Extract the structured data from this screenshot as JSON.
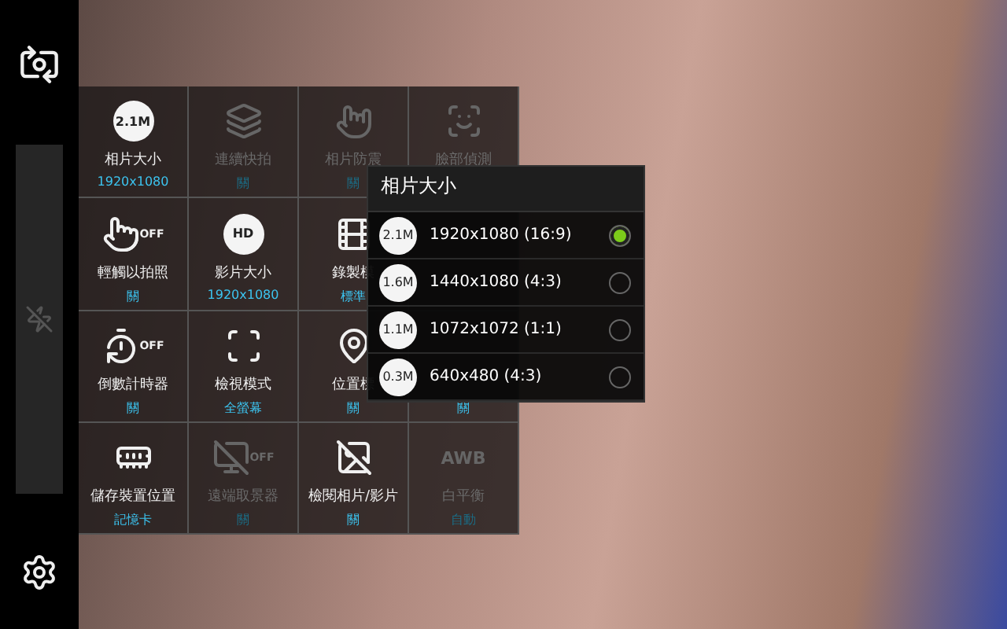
{
  "settings_grid": [
    [
      {
        "label": "相片大小",
        "value": "1920x1080",
        "badge": "2.1M",
        "disabled": false
      },
      {
        "label": "連續快拍",
        "value": "關",
        "disabled": true
      },
      {
        "label": "相片防震",
        "value": "關",
        "disabled": true
      },
      {
        "label": "臉部偵測",
        "disabled": true
      }
    ],
    [
      {
        "label": "輕觸以拍照",
        "value": "關",
        "badge": "OFF",
        "disabled": false
      },
      {
        "label": "影片大小",
        "value": "1920x1080",
        "badge": "HD",
        "disabled": false
      },
      {
        "label": "錄製模",
        "value": "標準",
        "disabled": false
      }
    ],
    [
      {
        "label": "倒數計時器",
        "value": "關",
        "badge": "OFF",
        "disabled": false
      },
      {
        "label": "檢視模式",
        "value": "全螢幕",
        "disabled": false
      },
      {
        "label": "位置標",
        "value": "關",
        "disabled": false
      },
      {
        "value": "關",
        "disabled": false
      }
    ],
    [
      {
        "label": "儲存裝置位置",
        "value": "記憶卡",
        "disabled": false
      },
      {
        "label": "遠端取景器",
        "value": "關",
        "badge": "OFF",
        "disabled": true
      },
      {
        "label": "檢閱相片/影片",
        "value": "關",
        "disabled": false
      },
      {
        "label": "白平衡",
        "value": "自動",
        "badge": "AWB",
        "disabled": true
      }
    ]
  ],
  "popup": {
    "title": "相片大小",
    "options": [
      {
        "badge": "2.1M",
        "label": "1920x1080 (16:9)",
        "selected": true
      },
      {
        "badge": "1.6M",
        "label": "1440x1080 (4:3)",
        "selected": false
      },
      {
        "badge": "1.1M",
        "label": "1072x1072 (1:1)",
        "selected": false
      },
      {
        "badge": "0.3M",
        "label": "640x480 (4:3)",
        "selected": false
      }
    ]
  }
}
